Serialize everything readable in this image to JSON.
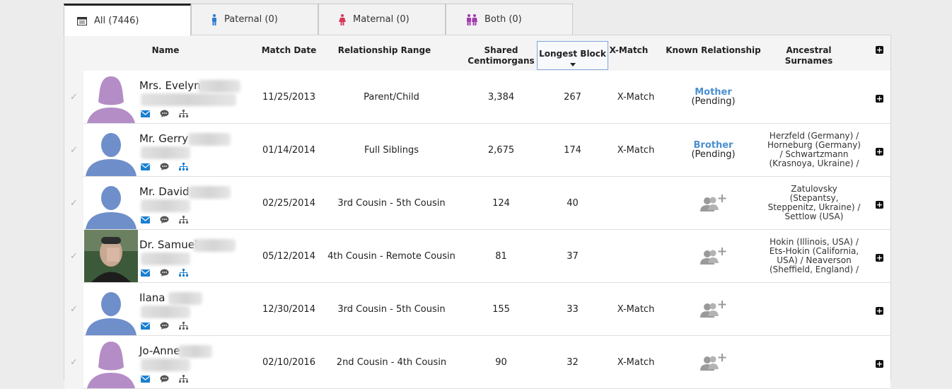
{
  "tabs": [
    {
      "label": "All (7446)",
      "icon": "list-icon",
      "color": "#333333"
    },
    {
      "label": "Paternal (0)",
      "icon": "male-icon",
      "color": "#2b7bd0"
    },
    {
      "label": "Maternal (0)",
      "icon": "female-icon",
      "color": "#d8375a"
    },
    {
      "label": "Both (0)",
      "icon": "couple-icon",
      "color": "#a23bb0"
    }
  ],
  "columns": {
    "name": "Name",
    "match_date": "Match Date",
    "relationship_range": "Relationship Range",
    "shared_cm": "Shared Centimorgans",
    "longest_block": "Longest Block",
    "x_match": "X-Match",
    "known_relationship": "Known Relationship",
    "ancestral_surnames": "Ancestral Surnames"
  },
  "colors": {
    "female_avatar": "#b48dc6",
    "male_avatar": "#6f8fcb",
    "link": "#4a8fd0",
    "icon_blue": "#1a7fd0",
    "icon_gray": "#666666"
  },
  "rows": [
    {
      "name": "Mrs. Evelyn",
      "avatar": "female",
      "date": "11/25/2013",
      "range": "Parent/Child",
      "cm": "3,384",
      "block": "267",
      "xmatch": "X-Match",
      "known": "Mother",
      "known_status": "(Pending)",
      "surnames": "",
      "tree_active": false
    },
    {
      "name": "Mr. Gerry",
      "avatar": "male",
      "date": "01/14/2014",
      "range": "Full Siblings",
      "cm": "2,675",
      "block": "174",
      "xmatch": "X-Match",
      "known": "Brother",
      "known_status": "(Pending)",
      "surnames": "Herzfeld (Germany) / Horneburg (Germany) / Schwartzmann (Krasnoya, Ukraine) /",
      "tree_active": true
    },
    {
      "name": "Mr. David",
      "avatar": "male",
      "date": "02/25/2014",
      "range": "3rd Cousin - 5th Cousin",
      "cm": "124",
      "block": "40",
      "xmatch": "",
      "known": "",
      "known_status": "",
      "surnames": "Zatulovsky (Stepantsy, Steppenitz, Ukraine) / Settlow (USA)",
      "tree_active": false
    },
    {
      "name": "Dr. Samuel",
      "avatar": "photo",
      "date": "05/12/2014",
      "range": "4th Cousin - Remote Cousin",
      "cm": "81",
      "block": "37",
      "xmatch": "",
      "known": "",
      "known_status": "",
      "surnames": "Hokin (Illinois, USA) / Ets-Hokin (California, USA) / Neaverson (Sheffield, England) /",
      "tree_active": true
    },
    {
      "name": "Ilana",
      "avatar": "male",
      "date": "12/30/2014",
      "range": "3rd Cousin - 5th Cousin",
      "cm": "155",
      "block": "33",
      "xmatch": "X-Match",
      "known": "",
      "known_status": "",
      "surnames": "",
      "tree_active": false
    },
    {
      "name": "Jo-Anne",
      "avatar": "female",
      "date": "02/10/2016",
      "range": "2nd Cousin - 4th Cousin",
      "cm": "90",
      "block": "32",
      "xmatch": "X-Match",
      "known": "",
      "known_status": "",
      "surnames": "",
      "tree_active": false
    }
  ]
}
